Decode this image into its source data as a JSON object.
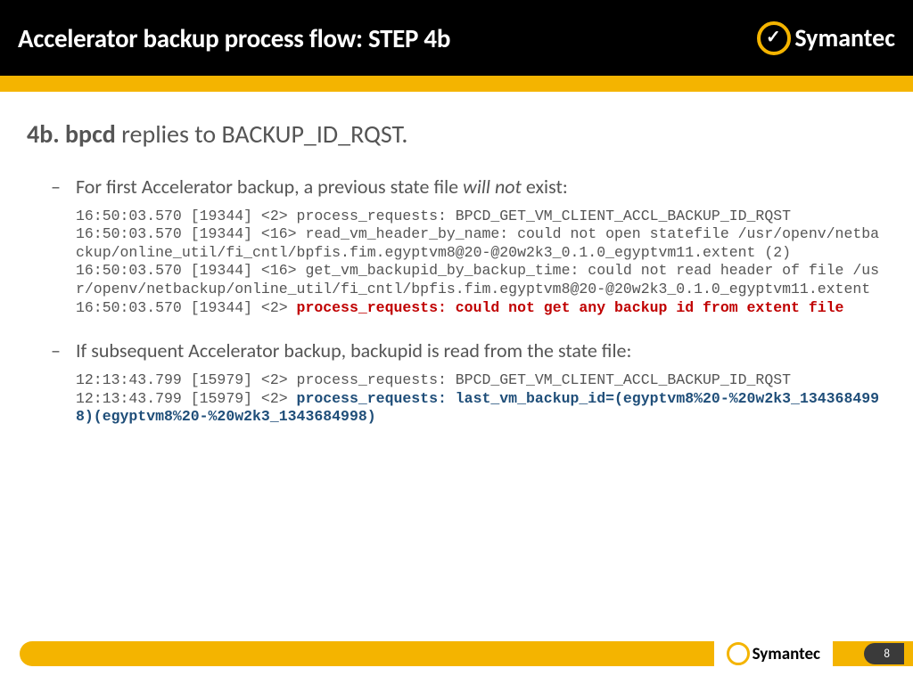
{
  "header": {
    "title": "Accelerator backup process flow: STEP 4b",
    "brand": "Symantec"
  },
  "heading": {
    "prefix": "4b. bpcd",
    "rest": " replies to BACKUP_ID_RQST."
  },
  "bullet1": {
    "pre": "For first Accelerator backup, a previous state file ",
    "italic": "will not",
    "post": " exist:"
  },
  "log1": {
    "plain": "16:50:03.570 [19344] <2> process_requests: BPCD_GET_VM_CLIENT_ACCL_BACKUP_ID_RQST\n16:50:03.570 [19344] <16> read_vm_header_by_name: could not open statefile /usr/openv/netbackup/online_util/fi_cntl/bpfis.fim.egyptvm8@20-@20w2k3_0.1.0_egyptvm11.extent (2)\n16:50:03.570 [19344] <16> get_vm_backupid_by_backup_time: could not read header of file /usr/openv/netbackup/online_util/fi_cntl/bpfis.fim.egyptvm8@20-@20w2k3_0.1.0_egyptvm11.extent\n16:50:03.570 [19344] <2> ",
    "red": "process_requests: could not get any backup id from extent file"
  },
  "bullet2": {
    "text": "If subsequent Accelerator backup, backupid is read from the state file:"
  },
  "log2": {
    "plain": "12:13:43.799 [15979] <2> process_requests: BPCD_GET_VM_CLIENT_ACCL_BACKUP_ID_RQST\n12:13:43.799 [15979] <2> ",
    "blue": "process_requests: last_vm_backup_id=(egyptvm8%20-%20w2k3_1343684998)(egyptvm8%20-%20w2k3_1343684998)"
  },
  "footer": {
    "brand": "Symantec",
    "page": "8"
  }
}
